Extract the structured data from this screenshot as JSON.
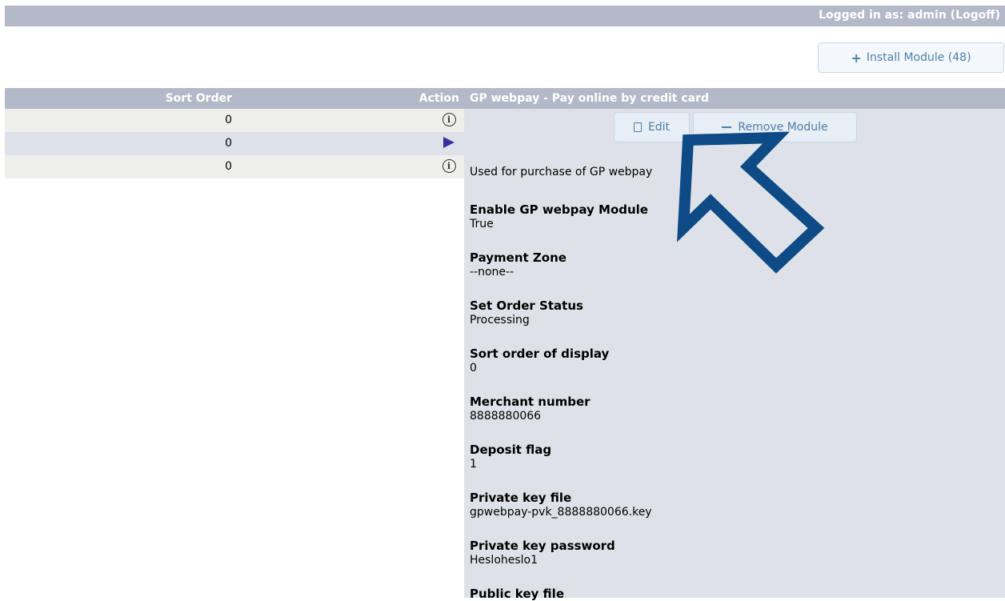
{
  "topbar": {
    "logged_prefix": "Logged in as: admin (",
    "logoff": "Logoff",
    "logged_suffix": ")"
  },
  "install_button": {
    "icon": "plus-icon",
    "label": "Install Module (48)"
  },
  "table": {
    "headers": {
      "sort_order": "Sort Order",
      "action": "Action"
    },
    "rows": [
      {
        "sort": "0",
        "action_icon": "info-icon"
      },
      {
        "sort": "0",
        "action_icon": "play-icon"
      },
      {
        "sort": "0",
        "action_icon": "info-icon"
      }
    ]
  },
  "panel": {
    "title": "GP webpay - Pay online by credit card",
    "edit_label": "Edit",
    "remove_label": "Remove Module",
    "description": "Used for purchase of GP webpay",
    "fields": [
      {
        "label": "Enable GP webpay Module",
        "value": "True"
      },
      {
        "label": "Payment Zone",
        "value": "--none--"
      },
      {
        "label": "Set Order Status",
        "value": "Processing"
      },
      {
        "label": "Sort order of display",
        "value": "0"
      },
      {
        "label": "Merchant number",
        "value": "8888880066"
      },
      {
        "label": "Deposit flag",
        "value": "1"
      },
      {
        "label": "Private key file",
        "value": "gpwebpay-pvk_8888880066.key"
      },
      {
        "label": "Private key password",
        "value": "Hesloheslo1"
      },
      {
        "label": "Public key file",
        "value": ""
      }
    ]
  },
  "colors": {
    "header_bg": "#b3b9c9",
    "panel_bg": "#dee2e8",
    "arrow": "#0d4a86",
    "button_text": "#4f7ea8"
  }
}
